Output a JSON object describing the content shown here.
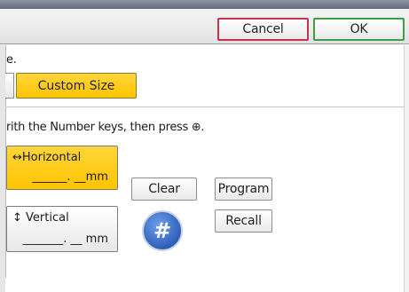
{
  "header": {
    "cancel_label": "Cancel",
    "ok_label": "OK"
  },
  "instructions": {
    "line1_partial": "e.",
    "line2_partial": "rith the Number keys, then press ⊕."
  },
  "size_buttons": {
    "custom_size_label": "Custom Size",
    "custom_size_selected": true
  },
  "dimensions": {
    "horizontal": {
      "label": "↔Horizontal",
      "value": "______. __mm",
      "selected": true
    },
    "vertical": {
      "label": "↕ Vertical",
      "value": "_______. __ mm",
      "selected": false
    }
  },
  "actions": {
    "clear_label": "Clear",
    "program_label": "Program",
    "recall_label": "Recall",
    "hash_label": "#"
  },
  "colors": {
    "selected_yellow": "#ffc400",
    "cancel_border": "#c8334a",
    "ok_border": "#3f9e44",
    "hash_blue": "#2f5fb8"
  }
}
